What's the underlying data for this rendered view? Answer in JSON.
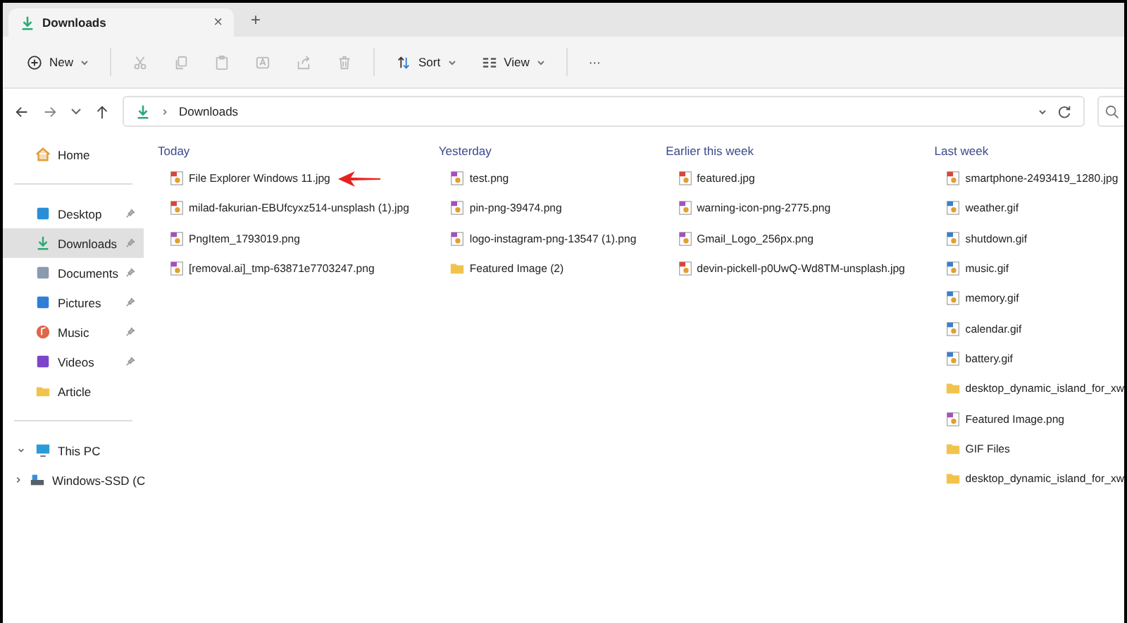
{
  "tab": {
    "title": "Downloads",
    "close": "×",
    "new_tab": "+"
  },
  "toolbar": [
    {
      "kind": "new",
      "label": "New",
      "disabled": false
    },
    {
      "kind": "cut",
      "disabled": true
    },
    {
      "kind": "copy",
      "disabled": true
    },
    {
      "kind": "paste",
      "disabled": true
    },
    {
      "kind": "rename",
      "disabled": true
    },
    {
      "kind": "share",
      "disabled": true
    },
    {
      "kind": "delete",
      "disabled": true
    },
    {
      "kind": "sort",
      "label": "Sort",
      "disabled": false
    },
    {
      "kind": "view",
      "label": "View",
      "disabled": false
    },
    {
      "kind": "more",
      "label": "···",
      "disabled": false
    }
  ],
  "address": {
    "path": "Downloads"
  },
  "sidebar": [
    {
      "kind": "home",
      "label": "Home",
      "pinned": false,
      "selected": false
    },
    {
      "kind": "divider"
    },
    {
      "kind": "desktop",
      "label": "Desktop",
      "pinned": true,
      "selected": false
    },
    {
      "kind": "downloads",
      "label": "Downloads",
      "pinned": true,
      "selected": true
    },
    {
      "kind": "documents",
      "label": "Documents",
      "pinned": true,
      "selected": false
    },
    {
      "kind": "pictures",
      "label": "Pictures",
      "pinned": true,
      "selected": false
    },
    {
      "kind": "music",
      "label": "Music",
      "pinned": true,
      "selected": false
    },
    {
      "kind": "videos",
      "label": "Videos",
      "pinned": true,
      "selected": false
    },
    {
      "kind": "folder",
      "label": "Article",
      "pinned": false,
      "selected": false
    },
    {
      "kind": "divider"
    },
    {
      "kind": "pc",
      "label": "This PC",
      "expanded": true,
      "selected": false
    },
    {
      "kind": "drive",
      "label": "Windows-SSD (C",
      "expanded": false,
      "selected": false
    }
  ],
  "groups": [
    {
      "title": "Today",
      "files": [
        {
          "name": "File Explorer Windows 11.jpg",
          "kind": "jpg",
          "marked": true
        },
        {
          "name": "milad-fakurian-EBUfcyxz514-unsplash (1).jpg",
          "kind": "jpg",
          "marked": false
        },
        {
          "name": "PngItem_1793019.png",
          "kind": "png",
          "marked": false
        },
        {
          "name": "[removal.ai]_tmp-63871e7703247.png",
          "kind": "png",
          "marked": false
        }
      ]
    },
    {
      "title": "Yesterday",
      "files": [
        {
          "name": "test.png",
          "kind": "png",
          "marked": false
        },
        {
          "name": "pin-png-39474.png",
          "kind": "png",
          "marked": false
        },
        {
          "name": "logo-instagram-png-13547 (1).png",
          "kind": "png",
          "marked": false
        },
        {
          "name": "Featured Image (2)",
          "kind": "folder",
          "marked": false
        }
      ]
    },
    {
      "title": "Earlier this week",
      "files": [
        {
          "name": "featured.jpg",
          "kind": "jpg",
          "marked": false
        },
        {
          "name": "warning-icon-png-2775.png",
          "kind": "png",
          "marked": false
        },
        {
          "name": "Gmail_Logo_256px.png",
          "kind": "png",
          "marked": false
        },
        {
          "name": "devin-pickell-p0UwQ-Wd8TM-unsplash.jpg",
          "kind": "jpg",
          "marked": false
        }
      ]
    },
    {
      "title": "Last week",
      "files": [
        {
          "name": "smartphone-2493419_1280.jpg",
          "kind": "jpg",
          "marked": false
        },
        {
          "name": "weather.gif",
          "kind": "gif",
          "marked": false
        },
        {
          "name": "shutdown.gif",
          "kind": "gif",
          "marked": false
        },
        {
          "name": "music.gif",
          "kind": "gif",
          "marked": false
        },
        {
          "name": "memory.gif",
          "kind": "gif",
          "marked": false
        },
        {
          "name": "calendar.gif",
          "kind": "gif",
          "marked": false
        },
        {
          "name": "battery.gif",
          "kind": "gif",
          "marked": false
        },
        {
          "name": "desktop_dynamic_island_for_xw",
          "kind": "folder",
          "marked": false
        },
        {
          "name": "Featured Image.png",
          "kind": "png",
          "marked": false
        },
        {
          "name": "GIF Files",
          "kind": "folder",
          "marked": false
        },
        {
          "name": "desktop_dynamic_island_for_xw",
          "kind": "folder",
          "marked": false
        }
      ]
    }
  ]
}
